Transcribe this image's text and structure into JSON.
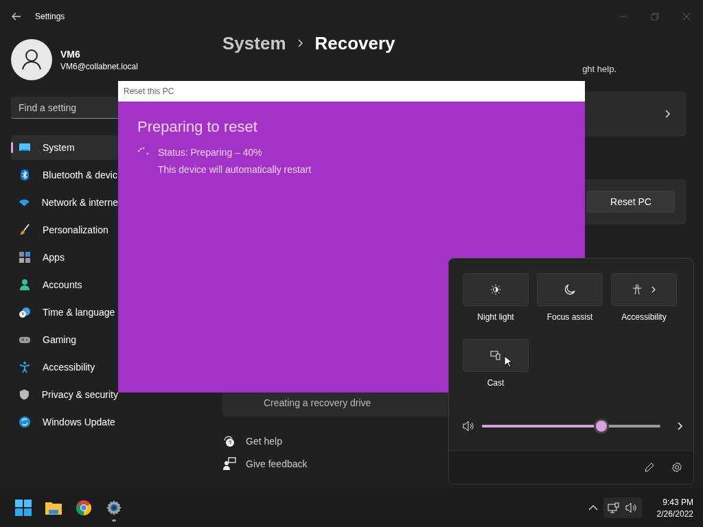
{
  "window": {
    "title": "Settings"
  },
  "user": {
    "name": "VM6",
    "email": "VM6@collabnet.local"
  },
  "search": {
    "placeholder": "Find a setting"
  },
  "nav": [
    {
      "label": "System",
      "selected": true
    },
    {
      "label": "Bluetooth & devic",
      "selected": false
    },
    {
      "label": "Network & interne",
      "selected": false
    },
    {
      "label": "Personalization",
      "selected": false
    },
    {
      "label": "Apps",
      "selected": false
    },
    {
      "label": "Accounts",
      "selected": false
    },
    {
      "label": "Time & language",
      "selected": false
    },
    {
      "label": "Gaming",
      "selected": false
    },
    {
      "label": "Accessibility",
      "selected": false
    },
    {
      "label": "Privacy & security",
      "selected": false
    },
    {
      "label": "Windows Update",
      "selected": false
    }
  ],
  "breadcrumb": {
    "parent": "System",
    "current": "Recovery"
  },
  "description_fragment": "ght help.",
  "reset_button": "Reset PC",
  "recovery_drive": "Creating a recovery drive",
  "links": [
    "Get help",
    "Give feedback"
  ],
  "dialog": {
    "title": "Reset this PC",
    "heading": "Preparing to reset",
    "status": "Status: Preparing – 40%",
    "note": "This device will automatically restart"
  },
  "quick_settings": {
    "tiles": [
      {
        "label": "Night light",
        "kind": "toggle",
        "on": false
      },
      {
        "label": "Focus assist",
        "kind": "toggle",
        "on": false
      },
      {
        "label": "Accessibility",
        "kind": "menu",
        "on": false
      },
      {
        "label": "Cast",
        "kind": "toggle",
        "on": false
      }
    ],
    "volume": {
      "level": 0.67
    }
  },
  "taskbar": {
    "apps": [
      {
        "running": false
      },
      {
        "running": false
      },
      {
        "running": false
      },
      {
        "running": true
      }
    ],
    "time": "9:43 PM",
    "date": "2/26/2022"
  }
}
